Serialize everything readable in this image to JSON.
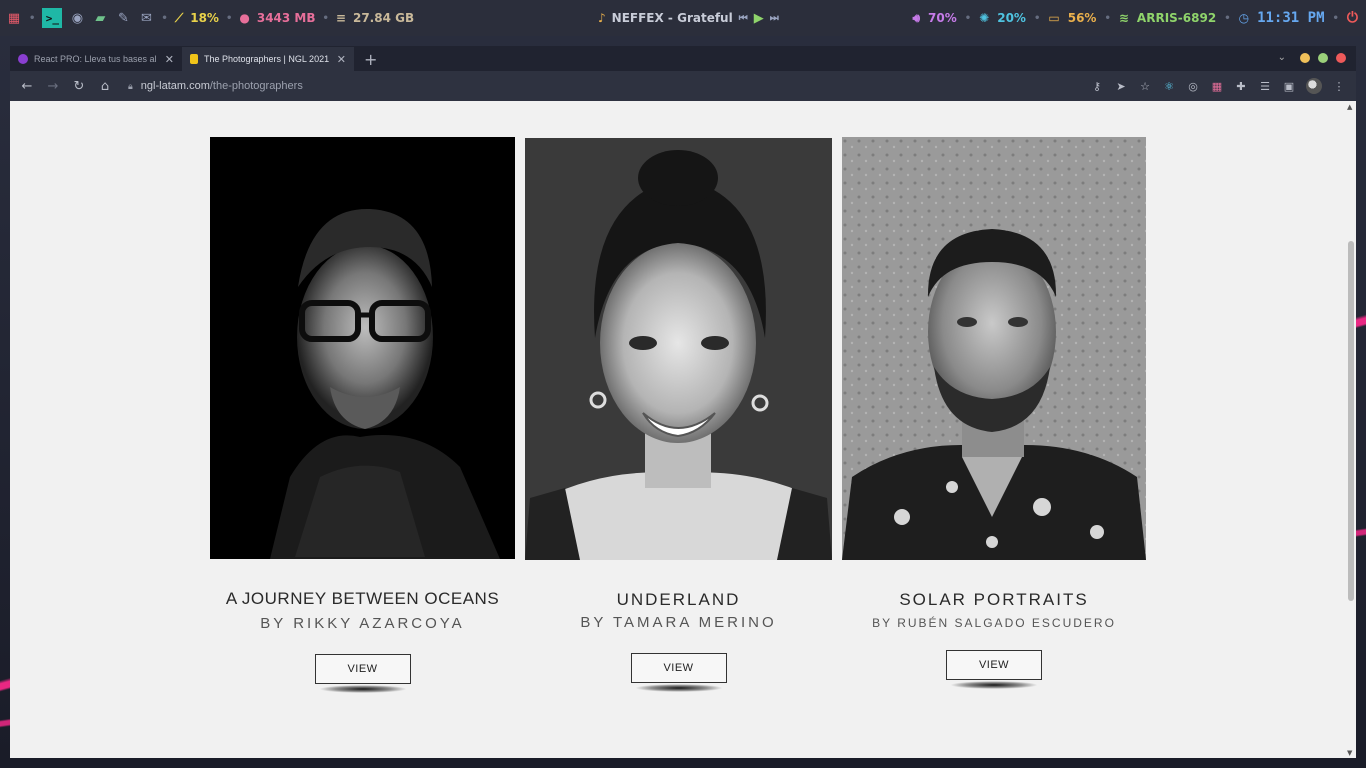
{
  "topbar": {
    "cpu": "18%",
    "memory": "3443 MB",
    "disk": "27.84 GB",
    "now_playing": "NEFFEX - Grateful",
    "volume": "70%",
    "brightness": "20%",
    "battery": "56%",
    "wifi": "ARRIS-6892",
    "time": "11:31 PM"
  },
  "browser": {
    "tabs": [
      {
        "title": "React PRO: Lleva tus bases al si",
        "active": false,
        "favicon_color": "#8a3fd1"
      },
      {
        "title": "The Photographers | NGL 2021",
        "active": true,
        "favicon_color": "#f0c419"
      }
    ],
    "new_tab_label": "+",
    "url_host": "ngl-latam.com",
    "url_path": "/the-photographers"
  },
  "cards": [
    {
      "title": "A JOURNEY BETWEEN OCEANS",
      "byline": "BY RIKKY AZARCOYA",
      "button": "VIEW"
    },
    {
      "title": "UNDERLAND",
      "byline": "BY TAMARA MERINO",
      "button": "VIEW"
    },
    {
      "title": "SOLAR PORTRAITS",
      "byline": "BY RUBÉN SALGADO ESCUDERO",
      "button": "VIEW"
    }
  ]
}
